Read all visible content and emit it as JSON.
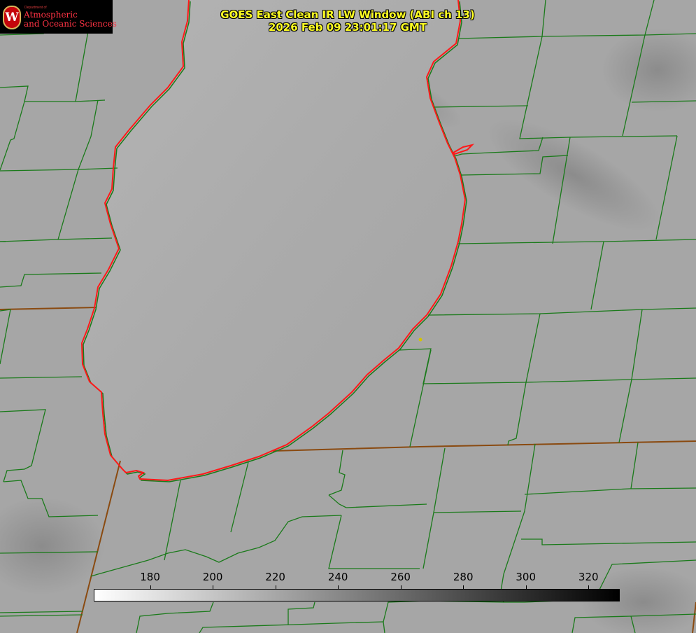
{
  "title": {
    "line1": "GOES East Clean IR LW Window (ABI ch 13)",
    "line2": "2026 Feb 09 23:01:17 GMT"
  },
  "logo": {
    "department": "Department of",
    "line1": "Atmospheric",
    "line2": "and Oceanic Sciences",
    "seal_letter": "W"
  },
  "colorbar": {
    "min": 162,
    "max": 330,
    "ticks": [
      {
        "value": 180,
        "label": "180"
      },
      {
        "value": 200,
        "label": "200"
      },
      {
        "value": 220,
        "label": "220"
      },
      {
        "value": 240,
        "label": "240"
      },
      {
        "value": 260,
        "label": "260"
      },
      {
        "value": 280,
        "label": "280"
      },
      {
        "value": 300,
        "label": "300"
      },
      {
        "value": 320,
        "label": "320"
      }
    ],
    "colors": {
      "low": "#ffffff",
      "high": "#000000"
    }
  },
  "colors": {
    "background": "#9e9e9e",
    "county_lines": "#1a7a1a",
    "state_lines": "#8a4a10",
    "lake_outline": "#ff1a1a",
    "title_text": "#ffff22",
    "marker": "#d4c400",
    "logo_background": "#000000",
    "logo_text": "#ff3344"
  },
  "map": {
    "feature": "lake-michigan",
    "icons": [
      "uw-seal-icon",
      "station-marker-icon"
    ]
  }
}
